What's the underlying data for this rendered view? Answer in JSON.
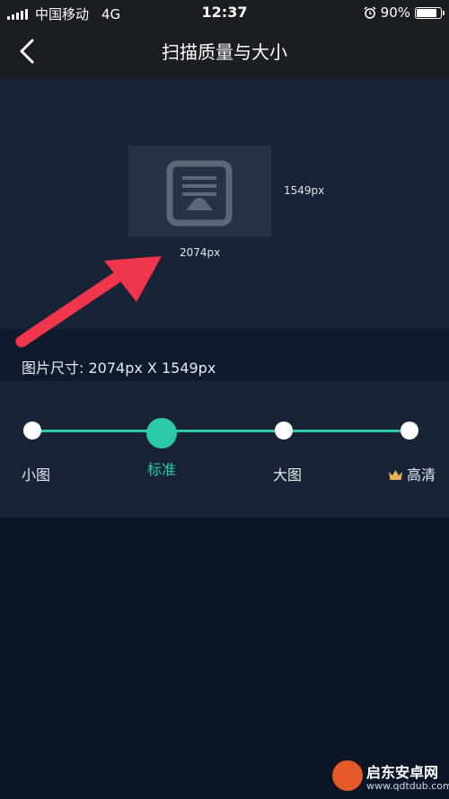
{
  "status_bar": {
    "carrier": "中国移动",
    "network": "4G",
    "time": "12:37",
    "battery_percent": "90%",
    "battery_level": 0.9
  },
  "nav": {
    "title": "扫描质量与大小"
  },
  "preview": {
    "height_label": "1549px",
    "width_label": "2074px"
  },
  "size_info": {
    "text": "图片尺寸:  2074px X 1549px"
  },
  "quality": {
    "options": [
      {
        "label": "小图"
      },
      {
        "label": "标准"
      },
      {
        "label": "大图"
      },
      {
        "label": "高清"
      }
    ],
    "selected_index": 1
  },
  "colors": {
    "accent": "#2bc9a6",
    "arrow": "#f0364d",
    "crown": "#e9b35a"
  },
  "watermark": {
    "main": "启东安卓网",
    "sub": "www.qdtdub.com"
  }
}
